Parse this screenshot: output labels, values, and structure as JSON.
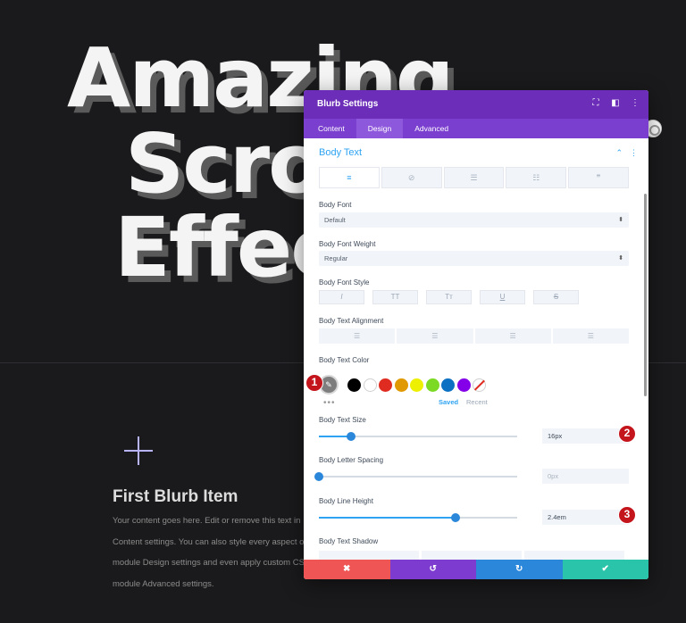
{
  "hero": {
    "line1": "Amazing",
    "line2": "Scro",
    "line3": "Effec"
  },
  "blurb": {
    "title": "First Blurb Item",
    "lines": [
      "Your content goes here. Edit or remove this text in",
      "Content settings. You can also style every aspect of",
      "module Design settings and even apply custom CSS",
      "module Advanced settings."
    ]
  },
  "modal": {
    "title": "Blurb Settings",
    "header_icons": [
      "fullscreen-icon",
      "split-view-icon",
      "more-options-icon"
    ],
    "tabs": [
      "Content",
      "Design",
      "Advanced"
    ],
    "active_tab": "Design",
    "section": {
      "title": "Body Text",
      "icons": [
        "chevron-up-icon",
        "section-more-icon"
      ]
    },
    "text_tabs": [
      "≡",
      "⊘",
      "☰",
      "☷",
      "❞"
    ],
    "fields": {
      "body_font_label": "Body Font",
      "body_font_value": "Default",
      "body_font_weight_label": "Body Font Weight",
      "body_font_weight_value": "Regular",
      "body_font_style_label": "Body Font Style",
      "body_font_style_buttons": [
        "I",
        "TT",
        "Tт",
        "U",
        "S"
      ],
      "body_text_alignment_label": "Body Text Alignment",
      "body_text_color_label": "Body Text Color",
      "body_text_size_label": "Body Text Size",
      "body_text_size_value": "16px",
      "body_text_size_fraction": 0.16,
      "body_letter_spacing_label": "Body Letter Spacing",
      "body_letter_spacing_value": "0px",
      "body_letter_spacing_fraction": 0.0,
      "body_line_height_label": "Body Line Height",
      "body_line_height_value": "2.4em",
      "body_line_height_fraction": 0.69,
      "body_text_shadow_label": "Body Text Shadow"
    },
    "color_swatches": [
      "#000000",
      "#ffffff",
      "#e02b20",
      "#e09900",
      "#edf000",
      "#7cda24",
      "#0c71c3",
      "#8300e9"
    ],
    "color_saved": "Saved",
    "color_recent": "Recent",
    "footer": {
      "cancel": "✖",
      "undo": "↺",
      "redo": "↻",
      "save": "✔",
      "colors": [
        "#ef5555",
        "#7e3bd0",
        "#2b87da",
        "#29c4a9"
      ]
    }
  },
  "callouts": [
    "1",
    "2",
    "3"
  ],
  "colors": {
    "accent": "#2ea3f2",
    "header": "#6c2eb9",
    "tabs": "#7b3fd0",
    "callout": "#c4141c"
  }
}
